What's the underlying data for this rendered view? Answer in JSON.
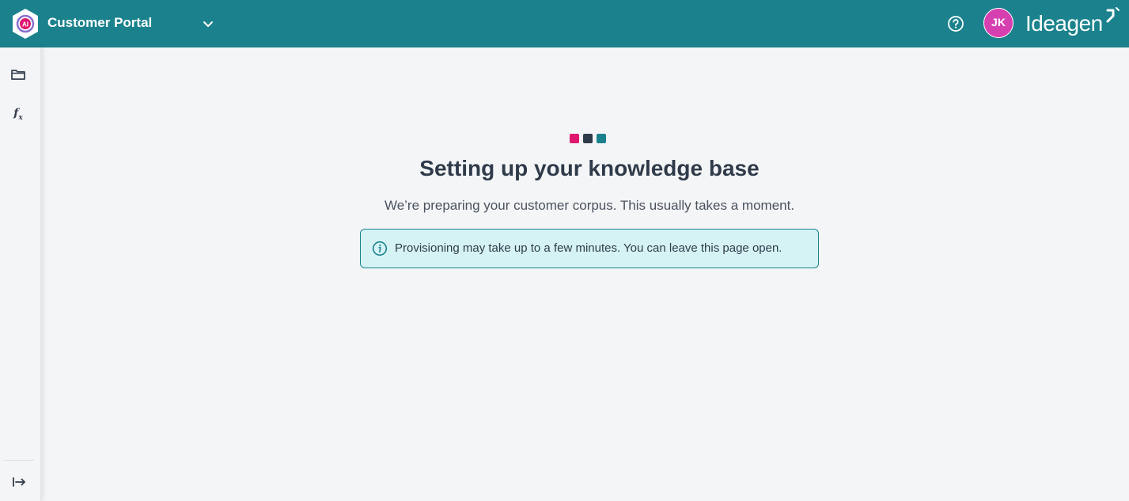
{
  "header": {
    "app_title": "Customer Portal",
    "avatar_initials": "JK",
    "brand_name": "Ideagen",
    "logo_badge": "AI",
    "colors": {
      "bar": "#1b828d",
      "avatar": "#d63fb0"
    }
  },
  "sidebar": {
    "items": [
      {
        "name": "folder",
        "icon": "folder-icon"
      },
      {
        "name": "functions",
        "icon": "function-icon",
        "label": "f",
        "sub": "x"
      }
    ],
    "expand_icon": "expand-arrow-icon"
  },
  "main": {
    "loader_colors": [
      "#e0176e",
      "#2f3b4a",
      "#1b828d"
    ],
    "heading": "Setting up your knowledge base",
    "subtext": "We’re preparing your customer corpus. This usually takes a moment.",
    "notice": {
      "icon": "info-icon",
      "text": "Provisioning may take up to a few minutes. You can leave this page open."
    }
  }
}
